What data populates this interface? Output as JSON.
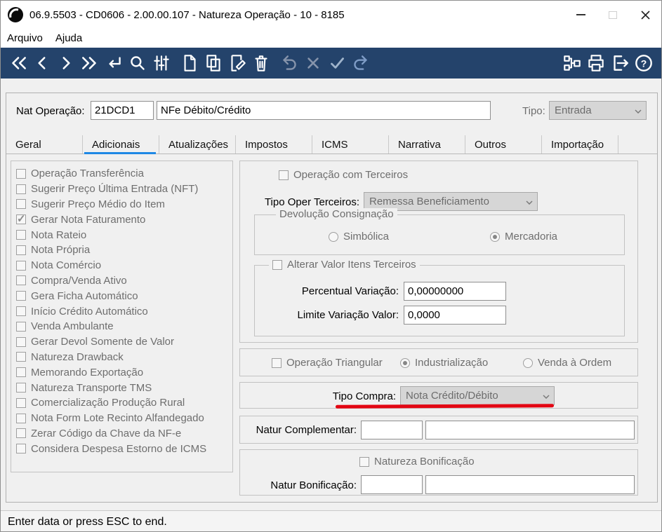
{
  "window": {
    "title": "06.9.5503 - CD0606 - 2.00.00.107 - Natureza Operação - 10 - 8185",
    "controls": [
      "minimize",
      "maximize",
      "close"
    ]
  },
  "menu": {
    "arquivo": "Arquivo",
    "ajuda": "Ajuda"
  },
  "toolbar": {
    "left_icons": [
      "first-record",
      "previous-record",
      "next-record",
      "last-record",
      "enter",
      "search",
      "filter",
      "new-document",
      "copy-document",
      "edit-document",
      "delete-document",
      "undo",
      "cancel",
      "confirm",
      "redo"
    ],
    "right_icons": [
      "related-queries",
      "print",
      "exit",
      "help"
    ],
    "bg_color": "#24436B"
  },
  "header": {
    "nat_label": "Nat Operação:",
    "nat_code": "21DCD1",
    "nat_desc": "NFe Débito/Crédito",
    "tipo_label": "Tipo:",
    "tipo_value": "Entrada"
  },
  "tabs": [
    {
      "label": "Geral",
      "active": false
    },
    {
      "label": "Adicionais",
      "active": true
    },
    {
      "label": "Atualizações",
      "active": false
    },
    {
      "label": "Impostos",
      "active": false
    },
    {
      "label": "ICMS",
      "active": false
    },
    {
      "label": "Narrativa",
      "active": false
    },
    {
      "label": "Outros",
      "active": false
    },
    {
      "label": "Importação",
      "active": false
    }
  ],
  "checklist": [
    {
      "label": "Operação Transferência",
      "checked": false
    },
    {
      "label": "Sugerir Preço Última Entrada (NFT)",
      "checked": false
    },
    {
      "label": "Sugerir Preço Médio do Item",
      "checked": false
    },
    {
      "label": "Gerar Nota Faturamento",
      "checked": true
    },
    {
      "label": "Nota Rateio",
      "checked": false
    },
    {
      "label": "Nota Própria",
      "checked": false
    },
    {
      "label": "Nota Comércio",
      "checked": false
    },
    {
      "label": "Compra/Venda Ativo",
      "checked": false
    },
    {
      "label": "Gera Ficha Automático",
      "checked": false
    },
    {
      "label": "Início Crédito Automático",
      "checked": false
    },
    {
      "label": "Venda Ambulante",
      "checked": false
    },
    {
      "label": "Gerar Devol Somente de Valor",
      "checked": false
    },
    {
      "label": "Natureza Drawback",
      "checked": false
    },
    {
      "label": "Memorando Exportação",
      "checked": false
    },
    {
      "label": "Natureza Transporte TMS",
      "checked": false
    },
    {
      "label": "Comercialização Produção Rural",
      "checked": false
    },
    {
      "label": "Nota Form Lote Recinto Alfandegado",
      "checked": false
    },
    {
      "label": "Zerar Código da Chave da NF-e",
      "checked": false
    },
    {
      "label": "Considera Despesa Estorno de ICMS",
      "checked": false
    }
  ],
  "terceiros": {
    "cb_label": "Operação com Terceiros",
    "cb_checked": false,
    "tipo_oper_label": "Tipo Oper Terceiros:",
    "tipo_oper_value": "Remessa Beneficiamento",
    "devolucao": {
      "title": "Devolução Consignação",
      "simbolica": {
        "label": "Simbólica",
        "selected": false
      },
      "mercadoria": {
        "label": "Mercadoria",
        "selected": true
      }
    },
    "alterar": {
      "cb_label": "Alterar Valor Itens Terceiros",
      "cb_checked": false,
      "percentual_label": "Percentual Variação:",
      "percentual_value": "0,00000000",
      "limite_label": "Limite Variação Valor:",
      "limite_value": "0,0000"
    }
  },
  "triangular": {
    "cb_label": "Operação Triangular",
    "cb_checked": false,
    "industrializacao": {
      "label": "Industrialização",
      "selected": true
    },
    "venda_ordem": {
      "label": "Venda à Ordem",
      "selected": false
    }
  },
  "tipo_compra": {
    "label": "Tipo Compra:",
    "value": "Nota Crédito/Débito"
  },
  "natur_complementar": {
    "label": "Natur Complementar:",
    "code": "",
    "desc": ""
  },
  "bonificacao": {
    "cb_label": "Natureza Bonificação",
    "cb_checked": false,
    "label": "Natur Bonificação:",
    "code": "",
    "desc": ""
  },
  "status": {
    "text": "Enter data or press ESC to end."
  },
  "annotation": {
    "color": "#e30613"
  }
}
